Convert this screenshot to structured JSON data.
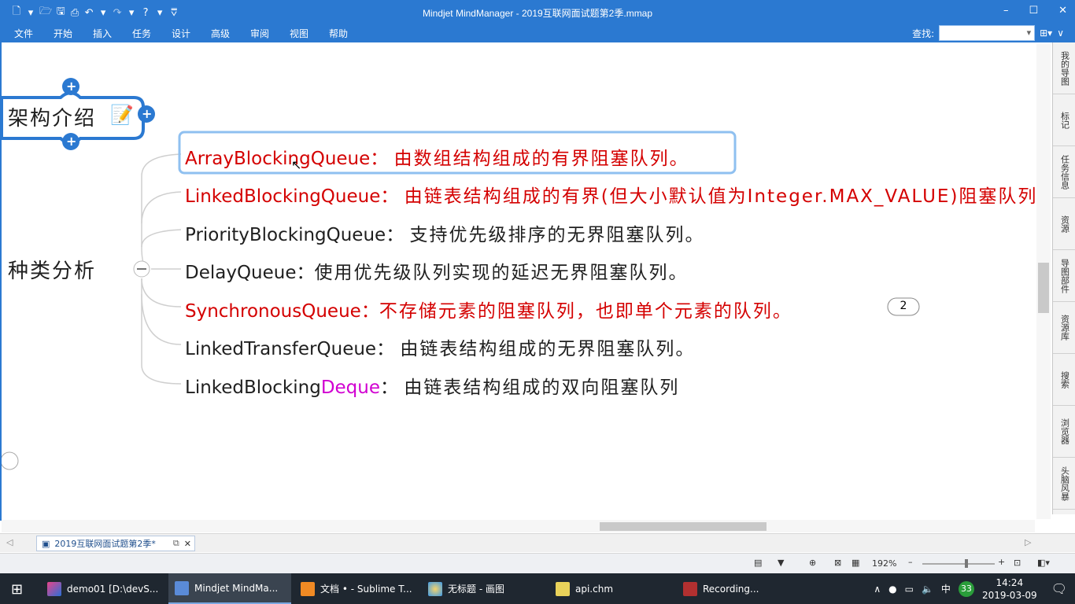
{
  "app": {
    "title": "Mindjet MindManager - 2019互联网面试题第2季.mmap",
    "qat_icons": [
      "new-icon",
      "open-icon",
      "save-icon",
      "print-icon",
      "undo-icon",
      "redo-icon",
      "help-icon"
    ],
    "win_controls": [
      "–",
      "☐",
      "✕"
    ]
  },
  "menu": [
    "文件",
    "开始",
    "插入",
    "任务",
    "设计",
    "高级",
    "审阅",
    "视图",
    "帮助"
  ],
  "find": {
    "label": "查找:"
  },
  "map": {
    "node_top": "架构介绍",
    "node_left": "种类分析",
    "topics": [
      {
        "name": "ArrayBlockingQueue",
        "sep": "：",
        "desc": "由数组结构组成的有界阻塞队列。"
      },
      {
        "name": "LinkedBlockingQueue",
        "sep": "：",
        "desc": "由链表结构组成的有界(但大小默认值为Integer.MAX_VALUE)阻塞队列"
      },
      {
        "name": "PriorityBlockingQueue",
        "sep": "：",
        "desc": "支持优先级排序的无界阻塞队列。"
      },
      {
        "name": "DelayQueue",
        "sep": "：",
        "desc": "使用优先级队列实现的延迟无界阻塞队列。"
      },
      {
        "name": "SynchronousQueue",
        "sep": "：",
        "desc": "不存储元素的阻塞队列，也即单个元素的队列。"
      },
      {
        "name": "LinkedTransferQueue",
        "sep": "：",
        "desc": "由链表结构组成的无界阻塞队列。"
      },
      {
        "name_a": "LinkedBlocking",
        "name_b": "Deque",
        "sep": "：",
        "desc": "由链表结构组成的双向阻塞队列"
      }
    ],
    "badge": "2"
  },
  "sidepanel": [
    "我的导图",
    "标记",
    "任务信息",
    "资源",
    "导图部件",
    "资源库",
    "搜索",
    "浏览器",
    "头脑风暴"
  ],
  "tab": {
    "label": "2019互联网面试题第2季*"
  },
  "status": {
    "zoom": "192%"
  },
  "taskbar": {
    "items": [
      "demo01 [D:\\devS...",
      "Mindjet MindMa...",
      "文档 • - Sublime T...",
      "无标题 - 画图",
      "api.chm",
      "Recording..."
    ],
    "ime": "中",
    "badge": "33",
    "time": "14:24",
    "date": "2019-03-09"
  },
  "colors": {
    "accent": "#2b79d1",
    "red_text": "#d40000",
    "magenta": "#d100d1",
    "selection": "#8fc0f0"
  }
}
